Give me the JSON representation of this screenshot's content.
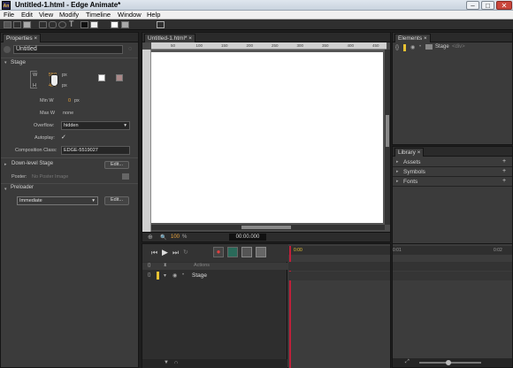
{
  "window": {
    "title": "Untitled-1.html - Edge Animate*",
    "app_icon": "An"
  },
  "menu": [
    "File",
    "Edit",
    "View",
    "Modify",
    "Timeline",
    "Window",
    "Help"
  ],
  "properties": {
    "tab_label": "Properties",
    "element_name": "Untitled",
    "stage_header": "Stage",
    "w_label": "W",
    "h_label": "H",
    "w_value": "550",
    "h_value": "400",
    "unit": "px",
    "min_w_label": "Min W",
    "min_w_value": "0",
    "max_w_label": "Max W",
    "max_w_value": "none",
    "overflow_label": "Overflow:",
    "overflow_value": "hidden",
    "autoplay_label": "Autoplay:",
    "composition_label": "Composition Class:",
    "composition_value": "EDGE-5519027",
    "downlevel_label": "Down-level Stage",
    "edit_label": "Edit...",
    "poster_label": "Poster:",
    "poster_value": "No Poster Image",
    "preloader_label": "Preloader",
    "preloader_value": "Immediate"
  },
  "stage": {
    "tab_label": "Untitled-1.html*",
    "ruler_marks": [
      "50",
      "100",
      "150",
      "200",
      "250",
      "300",
      "350",
      "400",
      "450"
    ],
    "zoom": "100",
    "zoom_unit": "%",
    "time": "00:00.000"
  },
  "elements": {
    "tab_label": "Elements",
    "item_label": "Stage",
    "item_tag": "<div>"
  },
  "library": {
    "tab_label": "Library",
    "sections": [
      "Assets",
      "Symbols",
      "Fonts"
    ]
  },
  "timeline": {
    "actions_label": "Actions",
    "stage_label": "Stage",
    "time_marks": [
      "0:00",
      "0:01",
      "0:02"
    ]
  },
  "colors": {
    "stage_bg": "#ffffff",
    "accent": "#e8a23a",
    "playhead": "#c0203a",
    "panel_bg": "#3b3b3b"
  }
}
